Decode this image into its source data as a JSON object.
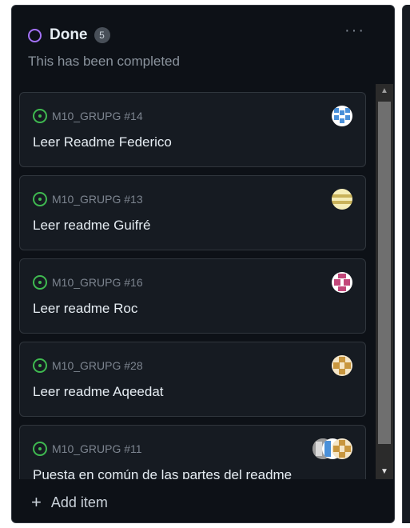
{
  "column": {
    "title": "Done",
    "count": "5",
    "description": "This has been completed",
    "more_icon": "kebab-horizontal-icon",
    "status_color": "#a371f7"
  },
  "cards": [
    {
      "repo": "M10_GRUPG #14",
      "title": "Leer Readme Federico",
      "avatar_colors": [
        "#ffffff",
        "#4a90d9"
      ]
    },
    {
      "repo": "M10_GRUPG #13",
      "title": "Leer readme Guifré",
      "avatar_colors": [
        "#f5edb8",
        "#c9b25a"
      ]
    },
    {
      "repo": "M10_GRUPG #16",
      "title": "Leer readme Roc",
      "avatar_colors": [
        "#ffffff",
        "#c2477a"
      ]
    },
    {
      "repo": "M10_GRUPG #28",
      "title": "Leer readme Aqeedat",
      "avatar_colors": [
        "#f5e6c8",
        "#c8963e"
      ]
    },
    {
      "repo": "M10_GRUPG #11",
      "title": "Puesta en común de las partes del readme",
      "avatar_colors": [
        "#f5e6c8",
        "#c8963e"
      ]
    }
  ],
  "footer": {
    "add_label": "Add item"
  },
  "colors": {
    "open_issue": "#3fb950",
    "background": "#0d1117",
    "card": "#161b22"
  }
}
